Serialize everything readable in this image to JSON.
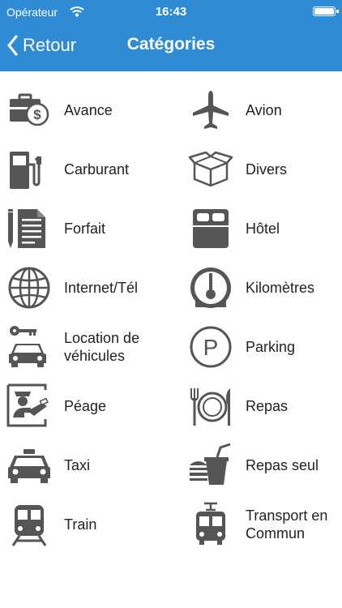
{
  "status_bar": {
    "carrier": "Opérateur",
    "time": "16:43"
  },
  "nav": {
    "back_label": "Retour",
    "title": "Catégories"
  },
  "categories": [
    {
      "label": "Avance",
      "icon": "briefcase-dollar-icon"
    },
    {
      "label": "Avion",
      "icon": "airplane-icon"
    },
    {
      "label": "Carburant",
      "icon": "fuel-pump-icon"
    },
    {
      "label": "Divers",
      "icon": "open-box-icon"
    },
    {
      "label": "Forfait",
      "icon": "document-pen-icon"
    },
    {
      "label": "Hôtel",
      "icon": "bed-icon"
    },
    {
      "label": "Internet/Tél",
      "icon": "globe-icon"
    },
    {
      "label": "Kilomètres",
      "icon": "speedometer-icon"
    },
    {
      "label": "Location de véhicules",
      "icon": "key-car-icon"
    },
    {
      "label": "Parking",
      "icon": "parking-icon"
    },
    {
      "label": "Péage",
      "icon": "toll-booth-icon"
    },
    {
      "label": "Repas",
      "icon": "plate-cutlery-icon"
    },
    {
      "label": "Taxi",
      "icon": "taxi-icon"
    },
    {
      "label": "Repas seul",
      "icon": "fastfood-icon"
    },
    {
      "label": "Train",
      "icon": "train-icon"
    },
    {
      "label": "Transport en Commun",
      "icon": "tram-icon"
    }
  ]
}
